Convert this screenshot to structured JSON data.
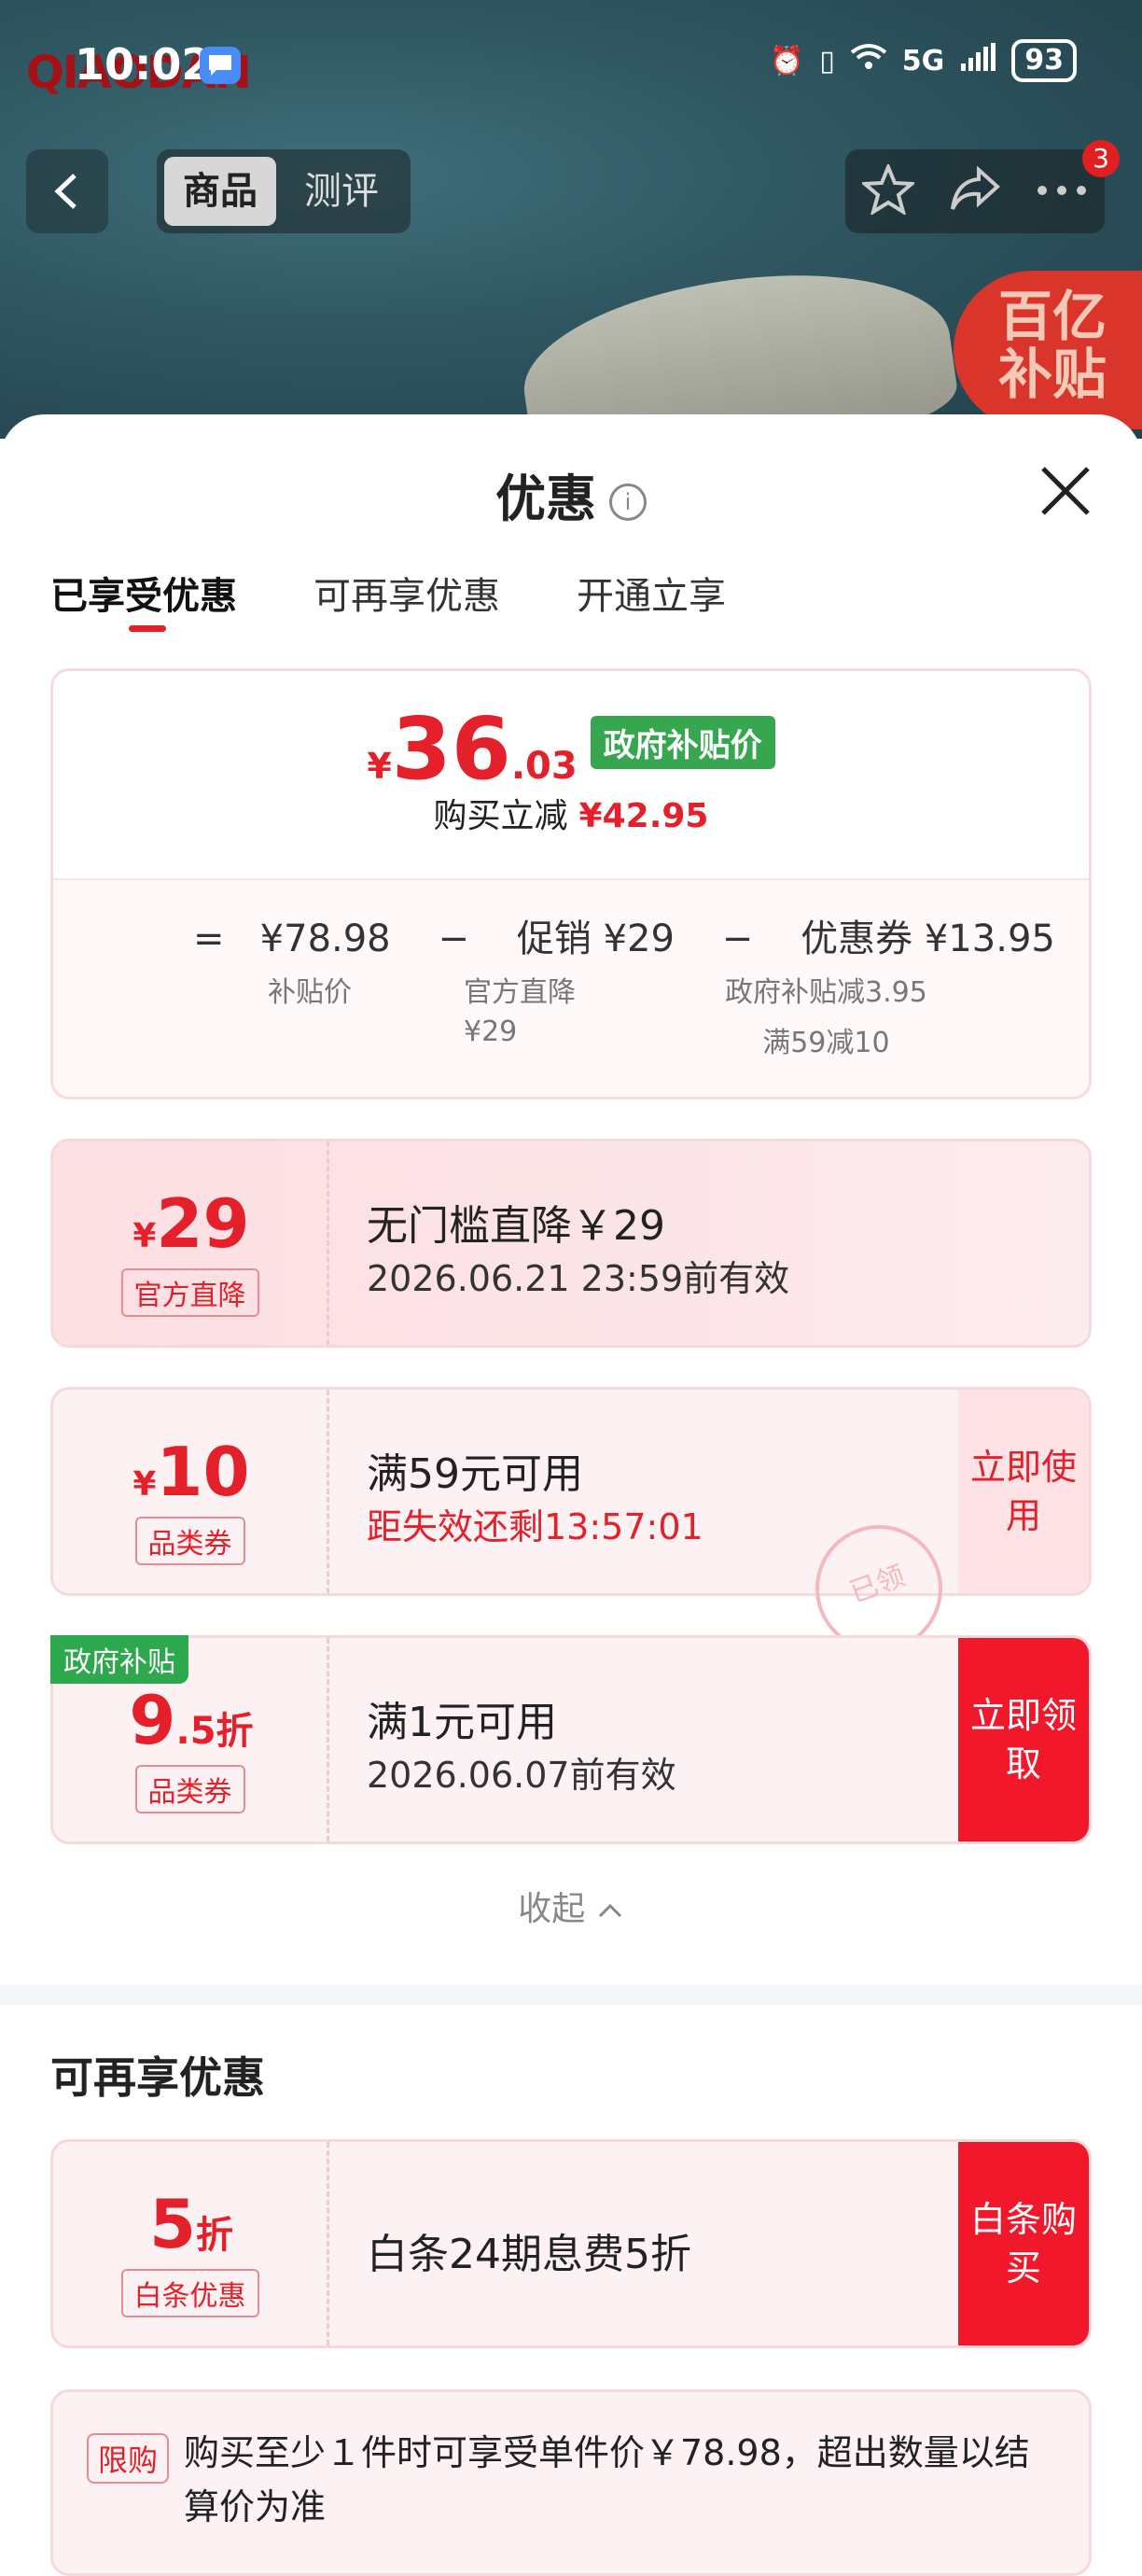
{
  "status_bar": {
    "time": "10:02",
    "network": "5G",
    "battery": "93"
  },
  "background": {
    "brand_logo": "QIAODAN",
    "subsidy_badge_line1": "百亿",
    "subsidy_badge_line2": "补贴"
  },
  "nav": {
    "tabs": [
      {
        "label": "商品",
        "active": true
      },
      {
        "label": "测评",
        "active": false
      }
    ],
    "more_badge_count": "3",
    "icons": [
      "back-icon",
      "star-icon",
      "share-icon",
      "more-icon"
    ]
  },
  "sheet": {
    "title": "优惠",
    "info_icon": "i",
    "segments": [
      {
        "label": "已享受优惠",
        "active": true
      },
      {
        "label": "可再享优惠",
        "active": false
      },
      {
        "label": "开通立享",
        "active": false
      }
    ]
  },
  "price_summary": {
    "currency": "¥",
    "final_int": "36",
    "final_dec": ".03",
    "final_tag": "政府补贴价",
    "reduce_label": "购买立减",
    "reduce_amount": "¥42.95",
    "formula": {
      "equals": "=",
      "base_price": "¥78.98",
      "minus1": "−",
      "promo": "促销 ¥29",
      "minus2": "−",
      "coupon": "优惠券 ¥13.95"
    },
    "base_label": "补贴价",
    "promo_detail_1": "官方直降",
    "promo_detail_2": "¥29",
    "coupon_detail_1": "政府补贴减3.95",
    "coupon_detail_2": "满59减10"
  },
  "coupons": [
    {
      "currency": "¥",
      "value": "29",
      "suffix": "",
      "kind": "官方直降",
      "line1": "无门槛直降￥29",
      "line2": "2026.06.21 23:59前有效",
      "cta": ""
    },
    {
      "currency": "¥",
      "value": "10",
      "suffix": "",
      "kind": "品类券",
      "line1": "满59元可用",
      "line2": "距失效还剩13:57:01",
      "cta": "立即使用",
      "stamp": "已领"
    },
    {
      "currency": "",
      "value": "9",
      "suffix": ".5折",
      "kind": "品类券",
      "line1": "满1元可用",
      "line2": "2026.06.07前有效",
      "cta": "立即领取",
      "corner_tag": "政府补贴"
    }
  ],
  "collapse_label": "收起",
  "more_offers": {
    "title": "可再享优惠",
    "card": {
      "value": "5",
      "suffix": "折",
      "kind": "白条优惠",
      "line1": "白条24期息费5折",
      "cta": "白条购买"
    }
  },
  "limit_note": {
    "tag": "限购",
    "text": "购买至少１件时可享受单件价￥78.98，超出数量以结算价为准"
  }
}
